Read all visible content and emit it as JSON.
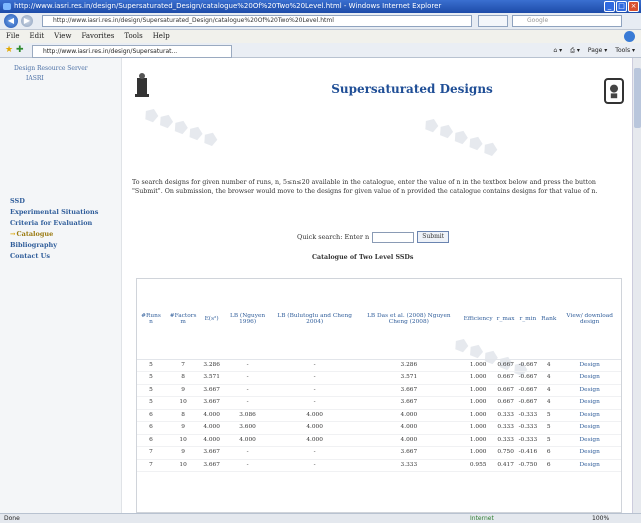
{
  "window": {
    "title": "http://www.iasri.res.in/design/Supersaturated_Design/catalogue%20Of%20Two%20Level.html - Windows Internet Explorer",
    "url": "http://www.iasri.res.in/design/Supersaturated_Design/catalogue%20Of%20Two%20Level.html",
    "tab_title": "http://www.iasri.res.in/design/Supersaturat...",
    "search_placeholder": "Google"
  },
  "menu": [
    "File",
    "Edit",
    "View",
    "Favorites",
    "Tools",
    "Help"
  ],
  "toolbar_right": [
    "Page ▾",
    "Tools ▾"
  ],
  "sidebar": {
    "top_line1": "Design Resource Server",
    "top_line2": "IASRI",
    "items": [
      {
        "label": "SSD",
        "active": false
      },
      {
        "label": "Experimental Situations",
        "active": false
      },
      {
        "label": "Criteria for Evaluation",
        "active": false
      },
      {
        "label": "Catalogue",
        "active": true
      },
      {
        "label": "Bibliography",
        "active": false
      },
      {
        "label": "Contact Us",
        "active": false
      }
    ]
  },
  "page": {
    "title": "Supersaturated Designs",
    "intro": "To search designs for given number of runs, n, 5≤n≤20 available in the catalogue, enter the value of n in the textbox below and press the button \"Submit\". On submission, the browser would move to the designs for given value of n provided the catalogue contains designs for that value of n.",
    "quick_search_label": "Quick search: Enter n",
    "quick_search_value": "",
    "submit_label": "Submit",
    "catalogue_title": "Catalogue of Two Level SSDs"
  },
  "table": {
    "headers": [
      "#Runs n",
      "#Factors m",
      "E(s²)",
      "LB (Nguyen 1996)",
      "LB (Bulutoglu and Cheng 2004)",
      "LB Das et al. (2008) Nguyen Cheng (2008)",
      "Efficiency",
      "r_max",
      "r_min",
      "Rank",
      "View/ download design"
    ],
    "rows": [
      [
        "5",
        "7",
        "3.286",
        "-",
        "-",
        "3.286",
        "1.000",
        "0.667",
        "-0.667",
        "4",
        "Design"
      ],
      [
        "5",
        "8",
        "3.571",
        "-",
        "-",
        "3.571",
        "1.000",
        "0.667",
        "-0.667",
        "4",
        "Design"
      ],
      [
        "5",
        "9",
        "3.667",
        "-",
        "-",
        "3.667",
        "1.000",
        "0.667",
        "-0.667",
        "4",
        "Design"
      ],
      [
        "5",
        "10",
        "3.667",
        "-",
        "-",
        "3.667",
        "1.000",
        "0.667",
        "-0.667",
        "4",
        "Design"
      ],
      [
        "6",
        "8",
        "4.000",
        "3.086",
        "4.000",
        "4.000",
        "1.000",
        "0.333",
        "-0.333",
        "5",
        "Design"
      ],
      [
        "6",
        "9",
        "4.000",
        "3.600",
        "4.000",
        "4.000",
        "1.000",
        "0.333",
        "-0.333",
        "5",
        "Design"
      ],
      [
        "6",
        "10",
        "4.000",
        "4.000",
        "4.000",
        "4.000",
        "1.000",
        "0.333",
        "-0.333",
        "5",
        "Design"
      ],
      [
        "7",
        "9",
        "3.667",
        "-",
        "-",
        "3.667",
        "1.000",
        "0.750",
        "-0.416",
        "6",
        "Design"
      ],
      [
        "7",
        "10",
        "3.667",
        "-",
        "-",
        "3.333",
        "0.955",
        "0.417",
        "-0.750",
        "6",
        "Design"
      ]
    ]
  },
  "statusbar": {
    "left": "Done",
    "zone": "Internet",
    "zoom": "100%"
  }
}
